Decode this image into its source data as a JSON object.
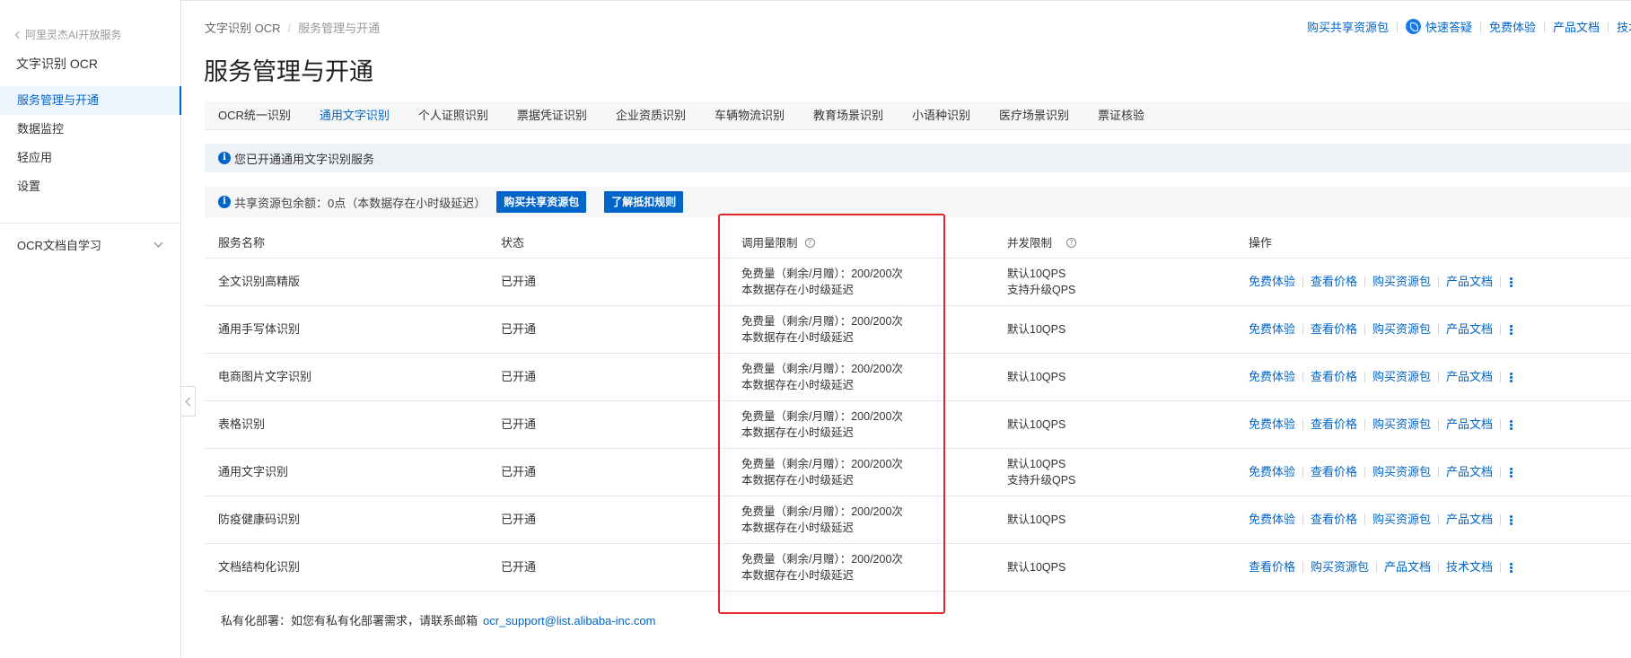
{
  "sidebar": {
    "back_label": "阿里灵杰AI开放服务",
    "product_title": "文字识别 OCR",
    "items": [
      {
        "label": "服务管理与开通",
        "active": true
      },
      {
        "label": "数据监控"
      },
      {
        "label": "轻应用"
      },
      {
        "label": "设置"
      }
    ],
    "group_label": "OCR文档自学习"
  },
  "breadcrumb": {
    "root": "文字识别 OCR",
    "separator": "/",
    "current": "服务管理与开通"
  },
  "header_links": {
    "buy_pack": "购买共享资源包",
    "quick_answer": "快速答疑",
    "free_trial": "免费体验",
    "product_docs": "产品文档",
    "tech_docs": "技术文档"
  },
  "page_title": "服务管理与开通",
  "tabs": [
    {
      "label": "OCR统一识别"
    },
    {
      "label": "通用文字识别",
      "active": true
    },
    {
      "label": "个人证照识别"
    },
    {
      "label": "票据凭证识别"
    },
    {
      "label": "企业资质识别"
    },
    {
      "label": "车辆物流识别"
    },
    {
      "label": "教育场景识别"
    },
    {
      "label": "小语种识别"
    },
    {
      "label": "医疗场景识别"
    },
    {
      "label": "票证核验"
    }
  ],
  "notice": "您已开通通用文字识别服务",
  "quota": {
    "text": "共享资源包余额：0点（本数据存在小时级延迟）",
    "buy_button": "购买共享资源包",
    "rules_button": "了解抵扣规则"
  },
  "table": {
    "headers": {
      "name": "服务名称",
      "status": "状态",
      "quota": "调用量限制",
      "concurrency": "并发限制",
      "actions": "操作"
    },
    "rows": [
      {
        "name": "全文识别高精版",
        "status": "已开通",
        "quota_line1": "免费量（剩余/月赠）：200/200次",
        "quota_line2": "本数据存在小时级延迟",
        "conc_line1": "默认10QPS",
        "conc_line2": "支持升级QPS",
        "actions": [
          "免费体验",
          "查看价格",
          "购买资源包",
          "产品文档"
        ]
      },
      {
        "name": "通用手写体识别",
        "status": "已开通",
        "quota_line1": "免费量（剩余/月赠）：200/200次",
        "quota_line2": "本数据存在小时级延迟",
        "conc_line1": "默认10QPS",
        "conc_line2": "",
        "actions": [
          "免费体验",
          "查看价格",
          "购买资源包",
          "产品文档"
        ]
      },
      {
        "name": "电商图片文字识别",
        "status": "已开通",
        "quota_line1": "免费量（剩余/月赠）：200/200次",
        "quota_line2": "本数据存在小时级延迟",
        "conc_line1": "默认10QPS",
        "conc_line2": "",
        "actions": [
          "免费体验",
          "查看价格",
          "购买资源包",
          "产品文档"
        ]
      },
      {
        "name": "表格识别",
        "status": "已开通",
        "quota_line1": "免费量（剩余/月赠）：200/200次",
        "quota_line2": "本数据存在小时级延迟",
        "conc_line1": "默认10QPS",
        "conc_line2": "",
        "actions": [
          "免费体验",
          "查看价格",
          "购买资源包",
          "产品文档"
        ]
      },
      {
        "name": "通用文字识别",
        "status": "已开通",
        "quota_line1": "免费量（剩余/月赠）：200/200次",
        "quota_line2": "本数据存在小时级延迟",
        "conc_line1": "默认10QPS",
        "conc_line2": "支持升级QPS",
        "actions": [
          "免费体验",
          "查看价格",
          "购买资源包",
          "产品文档"
        ]
      },
      {
        "name": "防疫健康码识别",
        "status": "已开通",
        "quota_line1": "免费量（剩余/月赠）：200/200次",
        "quota_line2": "本数据存在小时级延迟",
        "conc_line1": "默认10QPS",
        "conc_line2": "",
        "actions": [
          "免费体验",
          "查看价格",
          "购买资源包",
          "产品文档"
        ]
      },
      {
        "name": "文档结构化识别",
        "status": "已开通",
        "quota_line1": "免费量（剩余/月赠）：200/200次",
        "quota_line2": "本数据存在小时级延迟",
        "conc_line1": "默认10QPS",
        "conc_line2": "",
        "actions": [
          "查看价格",
          "购买资源包",
          "产品文档",
          "技术文档"
        ]
      }
    ]
  },
  "private_deploy": {
    "text": "私有化部署：如您有私有化部署需求，请联系邮箱",
    "email": "ocr_support@list.alibaba-inc.com"
  },
  "colors": {
    "primary": "#0064c8",
    "highlight": "#e5262b",
    "accent": "#ff6a00"
  }
}
